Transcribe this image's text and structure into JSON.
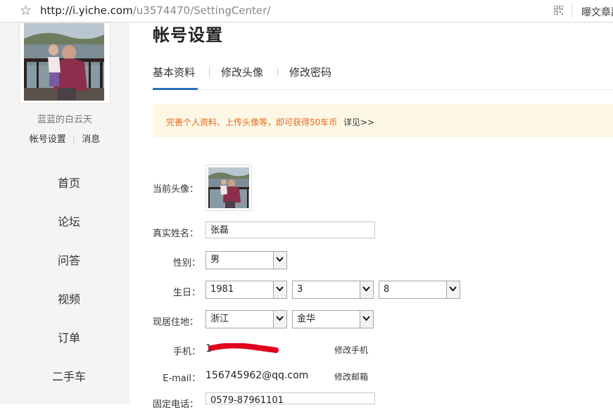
{
  "browser": {
    "url_host": "http://i.yiche.com",
    "url_path": "/u3574470/SettingCenter/",
    "extension_text": "曝文章副"
  },
  "sidebar": {
    "nickname": "蓝蓝的白云天",
    "account_settings": "帐号设置",
    "messages": "消息",
    "nav": [
      "首页",
      "论坛",
      "问答",
      "视频",
      "订单",
      "二手车"
    ]
  },
  "page": {
    "title": "帐号设置",
    "tabs": [
      "基本资料",
      "修改头像",
      "修改密码"
    ],
    "notice": "完善个人资料、上传头像等，即可获得50车币",
    "notice_link": "详见>>"
  },
  "form": {
    "avatar_label": "当前头像：",
    "name_label": "真实姓名：",
    "name_value": "张磊",
    "gender_label": "性别：",
    "gender_value": "男",
    "birthday_label": "生日：",
    "birth_year": "1981",
    "birth_month": "3",
    "birth_day": "8",
    "residence_label": "现居住地：",
    "province": "浙江",
    "city": "金华",
    "phone_label": "手机：",
    "phone_value": "1",
    "phone_action": "修改手机",
    "email_label": "E-mail：",
    "email_value": "156745962@qq.com",
    "email_action": "修改邮箱",
    "tel_label": "固定电话：",
    "tel_value": "0579-87961101"
  },
  "colors": {
    "accent": "#2e6fba",
    "notice_bg": "#fdf7e6",
    "notice_text": "#e66a1a",
    "redaction": "#e0001b"
  }
}
